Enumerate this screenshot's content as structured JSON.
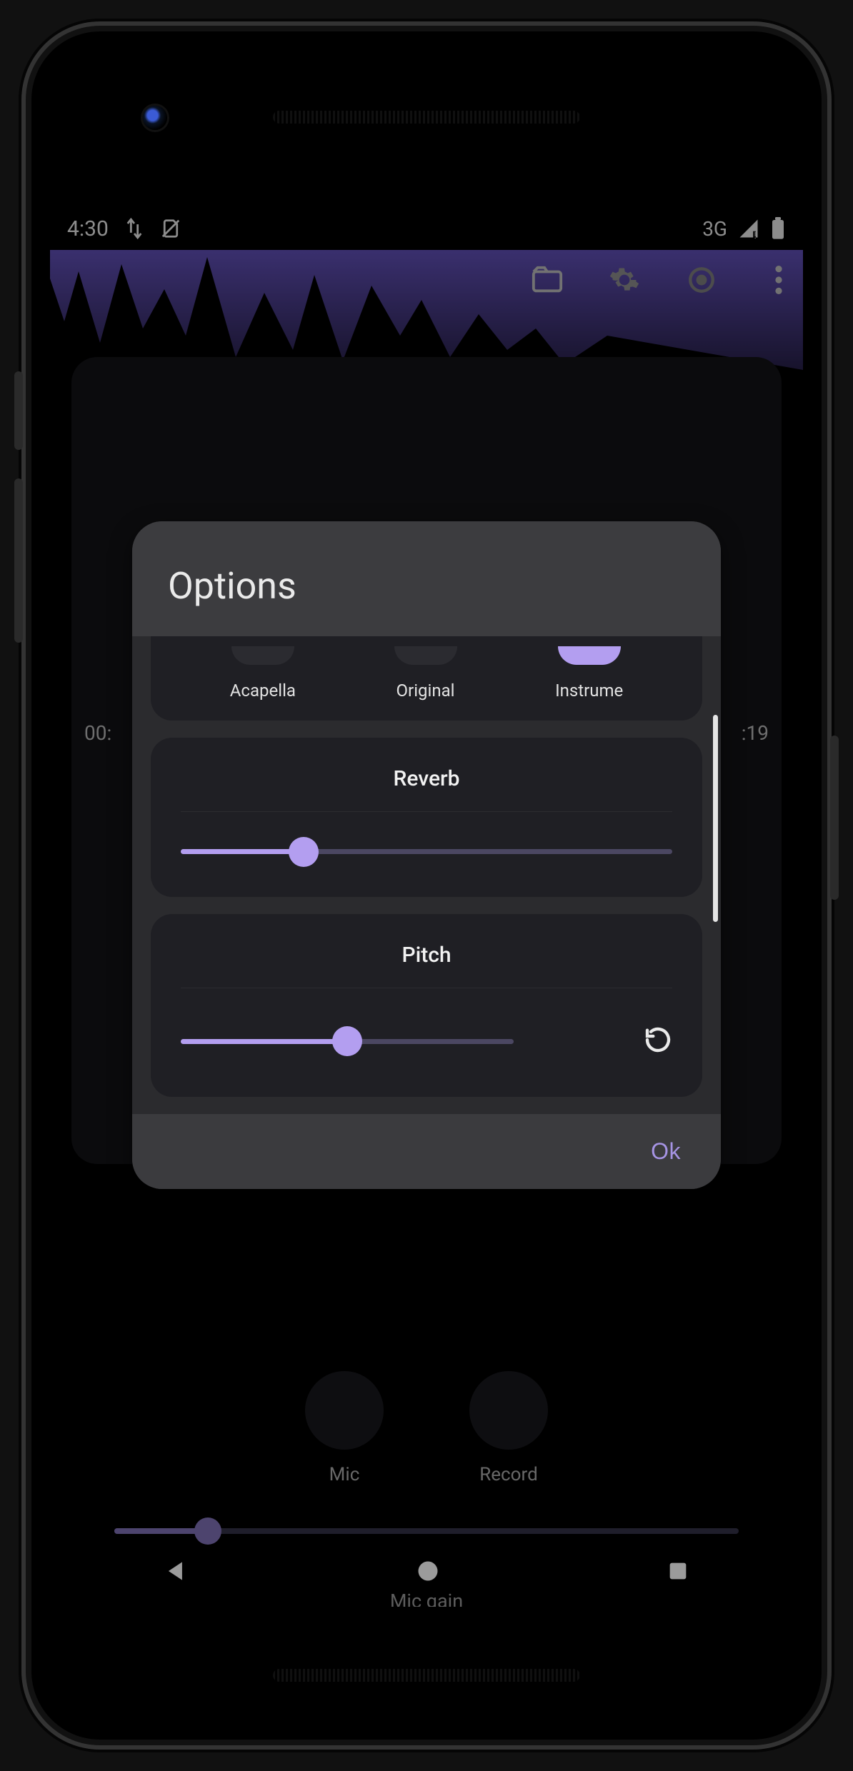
{
  "status": {
    "time": "4:30",
    "network": "3G"
  },
  "player": {
    "time_current": "00:",
    "time_total": ":19"
  },
  "controls": {
    "mic_label": "Mic",
    "record_label": "Record",
    "mic_gain_label": "Mic gain",
    "mic_gain_value": 15
  },
  "dialog": {
    "title": "Options",
    "modes": [
      {
        "label": "Acapella",
        "selected": false
      },
      {
        "label": "Original",
        "selected": false
      },
      {
        "label": "Instrume",
        "selected": true
      }
    ],
    "reverb": {
      "label": "Reverb",
      "value": 25
    },
    "pitch": {
      "label": "Pitch",
      "value": 50
    },
    "ok_label": "Ok"
  },
  "colors": {
    "accent": "#b39ef0",
    "accent_dim": "#8d7cc9",
    "panel": "#1f1f24",
    "dialog": "#37373a"
  }
}
